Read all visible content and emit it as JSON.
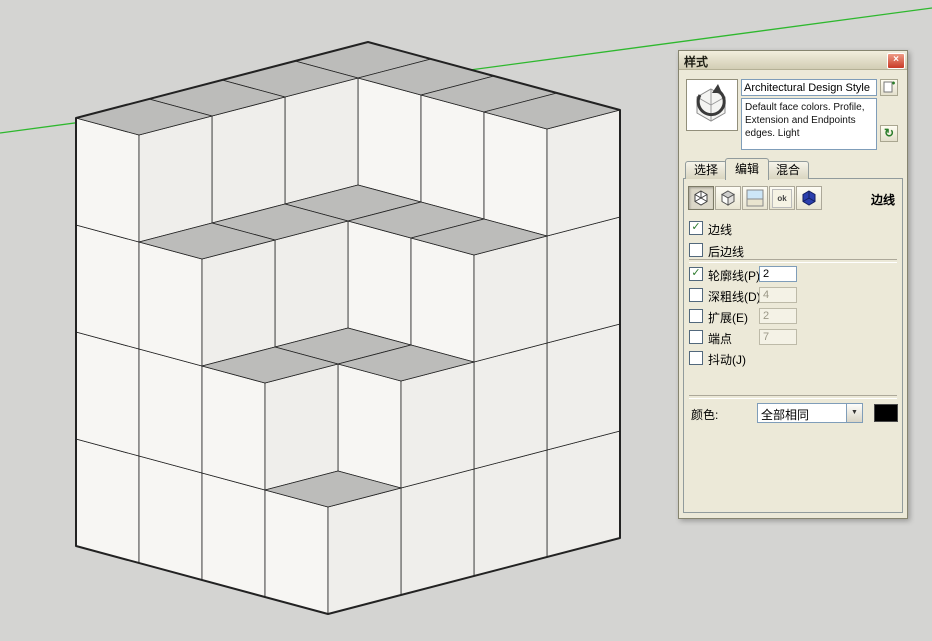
{
  "viewport": {
    "bg": "#d4d4d2",
    "axis_color": "#2eb82e",
    "cube": {
      "grid": 4,
      "heights": [
        [
          4,
          4,
          4,
          4
        ],
        [
          4,
          3,
          3,
          3
        ],
        [
          4,
          3,
          2,
          2
        ],
        [
          4,
          3,
          2,
          1
        ]
      ],
      "top": "#bcbcba",
      "left": "#f7f6f3",
      "right": "#efeeeb",
      "edge": "#222222",
      "profile_width": 2
    }
  },
  "panel": {
    "title": "样式",
    "close_glyph": "×",
    "style_name": "Architectural Design Style",
    "style_desc": "Default face colors. Profile, Extension and Endpoints edges. Light",
    "buttons": {
      "update_glyph": "↻"
    },
    "check_glyph": "✓",
    "tabs": [
      {
        "key": "select",
        "label": "选择",
        "active": false
      },
      {
        "key": "edit",
        "label": "编辑",
        "active": true
      },
      {
        "key": "mix",
        "label": "混合",
        "active": false
      }
    ],
    "toolbar": {
      "icons": [
        {
          "key": "edge-style",
          "active": true
        },
        {
          "key": "face-style",
          "active": false
        },
        {
          "key": "background",
          "active": false
        },
        {
          "key": "watermark",
          "active": false
        },
        {
          "key": "modeling",
          "active": false
        }
      ],
      "watermark_text": "ok",
      "section_label": "边线"
    },
    "checkboxes": [
      {
        "key": "edges",
        "label": "边线",
        "checked": true,
        "value": null,
        "enabled": true
      },
      {
        "key": "back-edges",
        "label": "后边线",
        "checked": false,
        "value": null,
        "enabled": true
      },
      {
        "key": "profiles",
        "label": "轮廓线(P)",
        "checked": true,
        "value": "2",
        "enabled": true
      },
      {
        "key": "depth-cue",
        "label": "深粗线(D)",
        "checked": false,
        "value": "4",
        "enabled": false
      },
      {
        "key": "extension",
        "label": "扩展(E)",
        "checked": false,
        "value": "2",
        "enabled": false
      },
      {
        "key": "endpoints",
        "label": "端点",
        "checked": false,
        "value": "7",
        "enabled": false
      },
      {
        "key": "jitter",
        "label": "抖动(J)",
        "checked": false,
        "value": null,
        "enabled": true
      }
    ],
    "color_row": {
      "label": "颜色:",
      "dropdown_value": "全部相同",
      "chevron": "▼",
      "swatch_color": "#000000"
    }
  }
}
